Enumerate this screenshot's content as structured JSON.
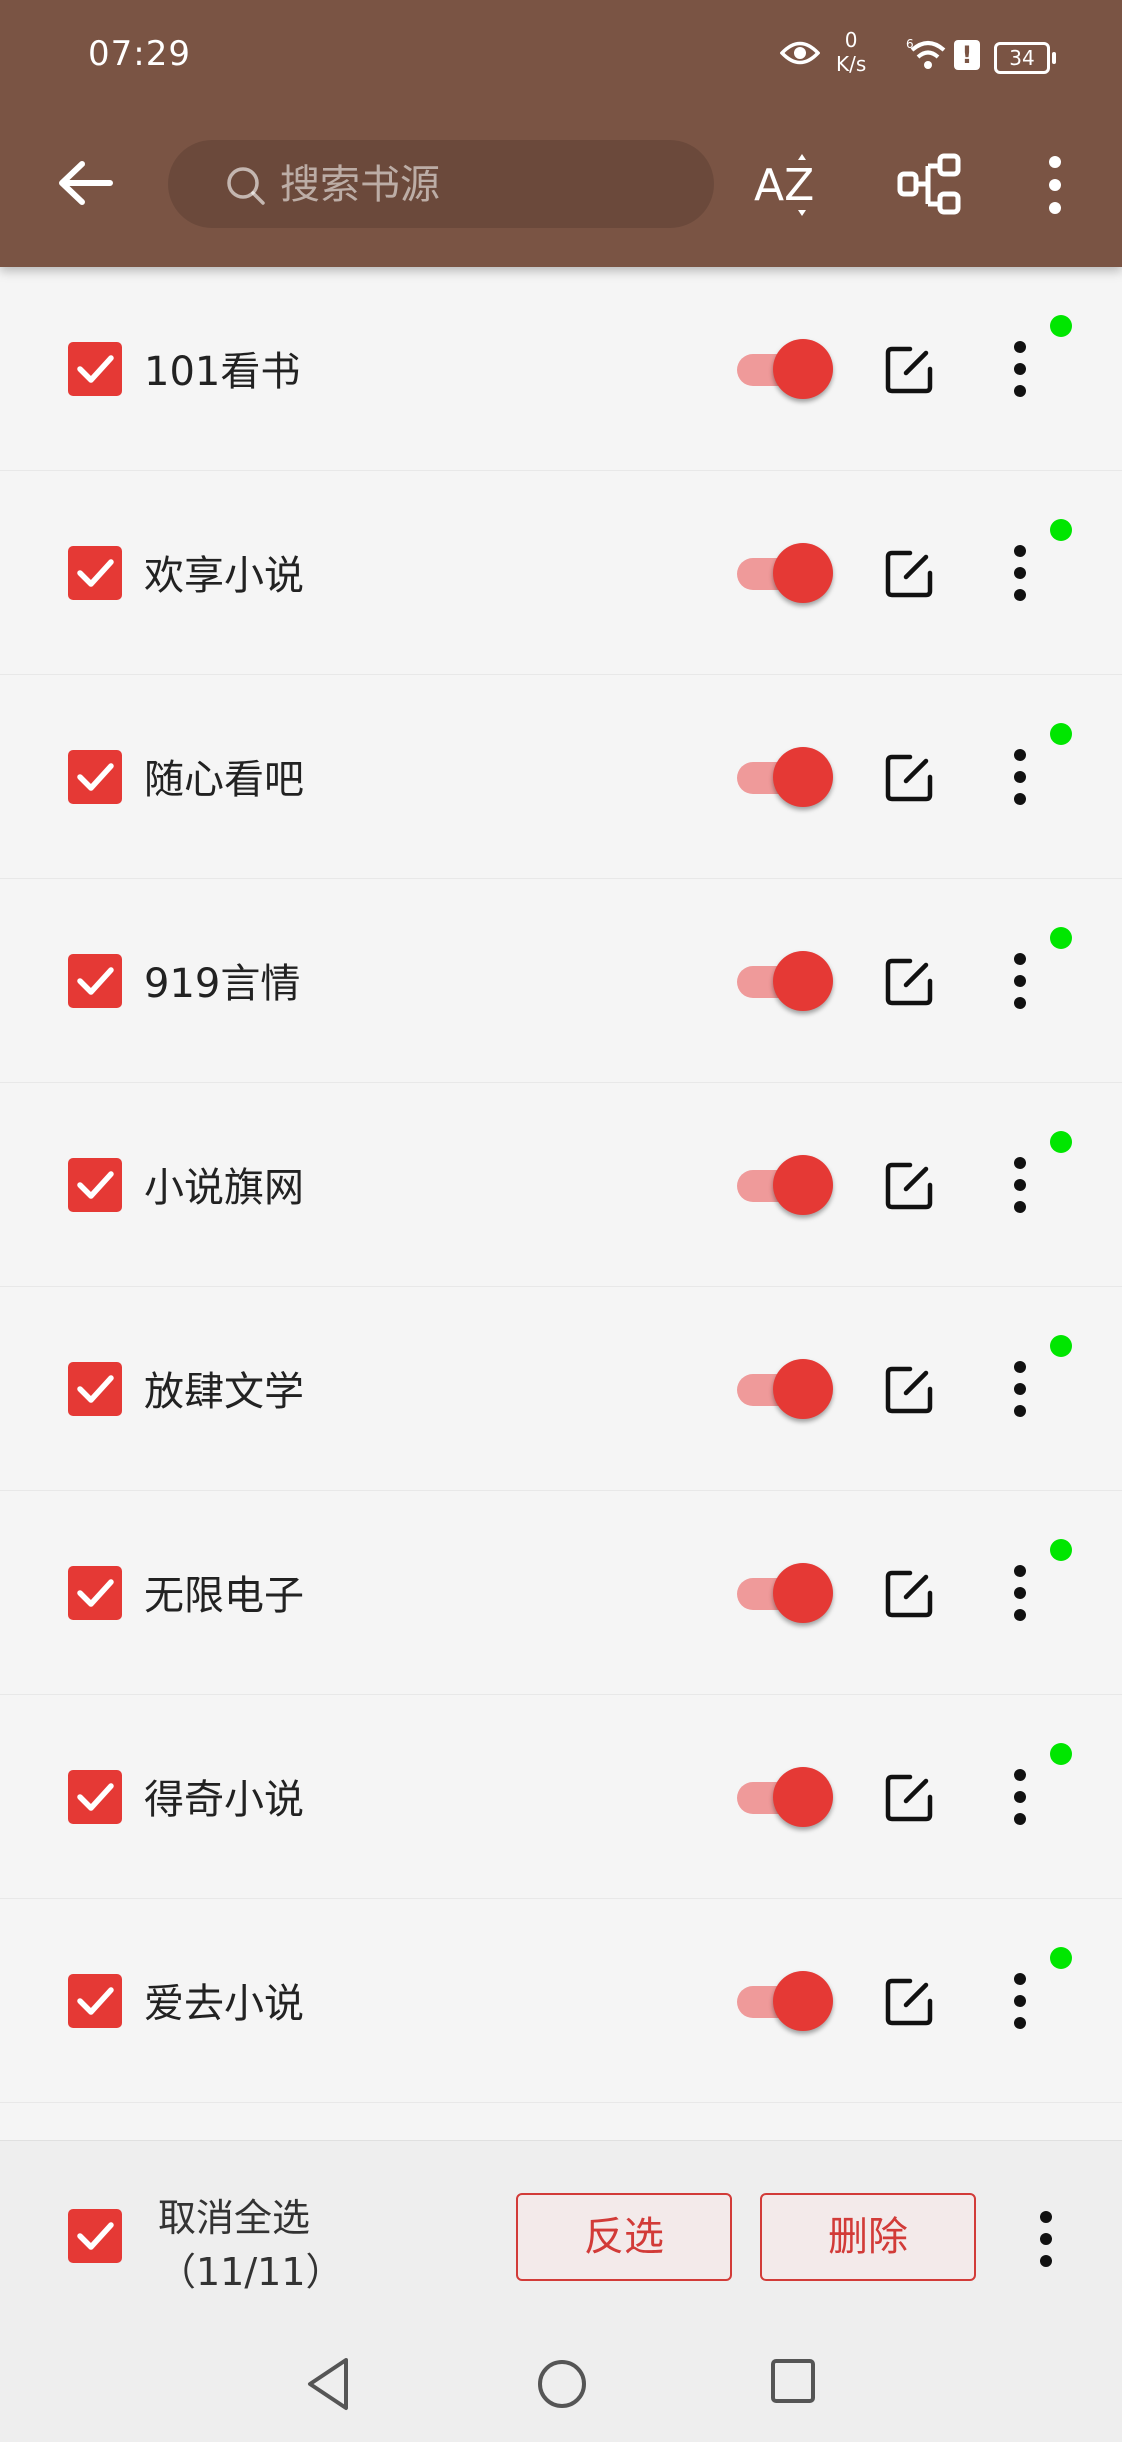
{
  "status_bar": {
    "time": "07:29",
    "speed_value": "0",
    "speed_unit": "K/s",
    "wifi_sup": "6",
    "alert": "!",
    "battery": "34"
  },
  "header": {
    "search_placeholder": "搜索书源",
    "sort_label": "AZ",
    "bg_color": "#7a5444"
  },
  "sources": [
    {
      "name": "101看书",
      "enabled": true,
      "checked": true
    },
    {
      "name": "欢享小说",
      "enabled": true,
      "checked": true
    },
    {
      "name": "随心看吧",
      "enabled": true,
      "checked": true
    },
    {
      "name": "919言情",
      "enabled": true,
      "checked": true
    },
    {
      "name": "小说旗网",
      "enabled": true,
      "checked": true
    },
    {
      "name": "放肆文学",
      "enabled": true,
      "checked": true
    },
    {
      "name": "无限电子",
      "enabled": true,
      "checked": true
    },
    {
      "name": "得奇小说",
      "enabled": true,
      "checked": true
    },
    {
      "name": "爱去小说",
      "enabled": true,
      "checked": true
    }
  ],
  "bottom_bar": {
    "select_all_label": "取消全选",
    "select_count": "（11/11）",
    "invert_label": "反选",
    "delete_label": "删除"
  },
  "colors": {
    "accent": "#e53935",
    "status_dot": "#00e600"
  }
}
